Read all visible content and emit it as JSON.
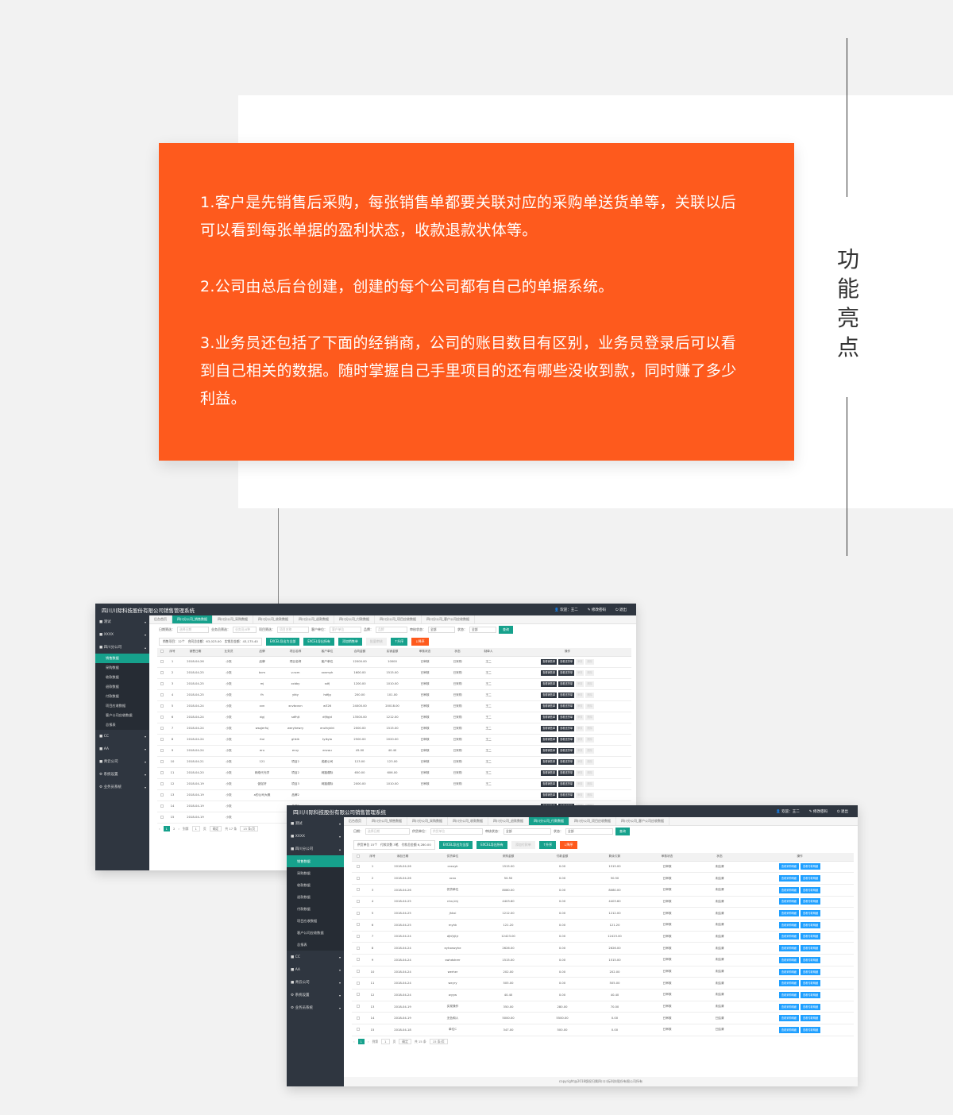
{
  "intro": {
    "p1": "1.客户是先销售后采购，每张销售单都要关联对应的采购单送货单等，关联以后可以看到每张单据的盈利状态，收款退款状体等。",
    "p2": "2.公司由总后台创建，创建的每个公司都有自己的单据系统。",
    "p3": "3.业务员还包括了下面的经销商，公司的账目数目有区别，业务员登录后可以看到自己相关的数据。随时掌握自己手里项目的还有哪些没收到款，同时赚了多少利益。"
  },
  "highlight_title": [
    "功",
    "能",
    "亮",
    "点"
  ],
  "colors": {
    "orange": "#fe5a1d",
    "teal": "#16a18c",
    "sidebar": "#2f3640",
    "blue": "#1e9fff"
  },
  "app": {
    "title": "四川川际科技股份有限公司销售管理系统",
    "welcome": "欢迎：王二",
    "change_pwd": "修改密码",
    "logout": "退出",
    "menu": {
      "m1": "测试",
      "m2": "XXXX",
      "m3": "四川分公司",
      "subs": [
        "销售数据",
        "采购数据",
        "收款数据",
        "退款数据",
        "付款数据",
        "项目应收数据",
        "客户公司应收数据",
        "总报表"
      ],
      "m4": "CC",
      "m5": "AA",
      "m6": "青云公司",
      "m7": "系统设置",
      "m8": "业务员系统"
    }
  },
  "sales": {
    "tabs": [
      "后台首页",
      "四川分公司_销售数据",
      "四川分公司_采购数据",
      "四川分公司_收款数据",
      "四川分公司_退款数据",
      "四川分公司_付款数据",
      "四川分公司_项目应收数据",
      "四川分公司_客户公司应收数据"
    ],
    "filter": {
      "date_label": "日期筛选：",
      "date_ph": "选择日期",
      "staff_label": "业务员筛选：",
      "staff_ph": "业务员(6种",
      "proj_label": "项目筛选：",
      "proj_ph": "项目名称",
      "cust_label": "客户单位：",
      "cust_ph": "客户单位",
      "brand_label": "品牌：",
      "brand_ph": "品牌",
      "audit_label": "审核状态：",
      "audit_val": "全部",
      "state_label": "状态：",
      "state_val": "全部",
      "query": "查询"
    },
    "summary": {
      "a": "销售项目：12个",
      "b": "合同总金额：63,023.00",
      "c": "实销总金额：43,175.40"
    },
    "buttons": {
      "export_all": "EXCEL导出为全部",
      "export": "EXCEL导出所有",
      "add": "添加销售单",
      "batch": "批量审核",
      "asc": "↑升序",
      "desc": "↓降序"
    },
    "headers": [
      "序号",
      "销售日期",
      "业务员",
      "品牌",
      "项目名称",
      "客户单位",
      "合同金额",
      "实销金额",
      "审核状态",
      "状态",
      "制单人",
      "操作"
    ],
    "op_labels": {
      "a": "查看销售单",
      "b": "查看送货单",
      "c": "审核",
      "d": "删除"
    },
    "rows": [
      [
        "1",
        "2018-04-26",
        "小张",
        "品牌",
        "项目名称",
        "客户单位",
        "12000.00",
        "10000",
        "已审核",
        "已采购",
        "王二"
      ],
      [
        "2",
        "2018-04-25",
        "小张",
        "bcm",
        "v.ncm",
        "xxnmyh",
        "1600.00",
        "1515.00",
        "已审核",
        "已采购",
        "王二"
      ],
      [
        "3",
        "2018-04-25",
        "小张",
        "mj",
        "xcbby",
        "sdfj",
        "1200.00",
        "1010.00",
        "已审核",
        "已采购",
        "王二"
      ],
      [
        "4",
        "2018-04-25",
        "小张",
        "fh",
        "ykty",
        "hdfjg",
        "200.00",
        "101.00",
        "已审核",
        "已采购",
        "王二"
      ],
      [
        "5",
        "2018-04-24",
        "小张",
        "xvn",
        "xcvbcxvn",
        "w326",
        "24000.00",
        "20018.00",
        "已审核",
        "已采购",
        "王二"
      ],
      [
        "6",
        "2018-04-24",
        "小张",
        "dgj",
        "sdfhjt",
        "dfjfgjd",
        "13500.00",
        "1212.00",
        "已审核",
        "已采购",
        "王二"
      ],
      [
        "7",
        "2018-04-24",
        "小张",
        "wsqjerfuj",
        "weryhewry",
        "eruthykkt",
        "2000.00",
        "1515.00",
        "已审核",
        "已采购",
        "王二"
      ],
      [
        "8",
        "2018-04-24",
        "小张",
        "rtui",
        "ghkik",
        "tyikyio",
        "2500.00",
        "2020.00",
        "已审核",
        "已采购",
        "王二"
      ],
      [
        "9",
        "2018-04-24",
        "小张",
        "eru",
        "eruy",
        "eruwu",
        "45.00",
        "40.40",
        "已审核",
        "已采购",
        "王二"
      ],
      [
        "10",
        "2018-04-21",
        "小张",
        "121",
        "项目2",
        "成都公司",
        "123.00",
        "123.00",
        "已审核",
        "已采购",
        "王二"
      ],
      [
        "11",
        "2018-04-20",
        "小张",
        "网络代光学",
        "项目2",
        "网路遭际",
        "650.00",
        "606.00",
        "已审核",
        "已采购",
        "王二"
      ],
      [
        "12",
        "2018-04-19",
        "小张",
        "促促好",
        "项目3",
        "网路遭际",
        "2000.00",
        "1010.00",
        "已审核",
        "已采购",
        "王二"
      ],
      [
        "13",
        "2018-04-19",
        "小张",
        "a的公司大概",
        "品牌2",
        "",
        "",
        "",
        "",
        "",
        ""
      ],
      [
        "14",
        "2018-04-19",
        "小张",
        "",
        "品牌3",
        "",
        "",
        "",
        "",
        "",
        ""
      ],
      [
        "15",
        "2018-04-19",
        "小张",
        "",
        "2",
        "",
        "",
        "",
        "",
        "",
        ""
      ]
    ],
    "pager": {
      "p1": "1",
      "p2": "2",
      "to": "到第",
      "page": "1",
      "unit": "页",
      "ok": "确定",
      "total": "共 17 条",
      "size": "15 条/页"
    }
  },
  "payment": {
    "tabs": [
      "后台首页",
      "四川分公司_销售数据",
      "四川分公司_采购数据",
      "四川分公司_收款数据",
      "四川分公司_退款数据",
      "四川分公司_付款数据",
      "四川分公司_项目应收数据",
      "四川分公司_客户公司应收数据"
    ],
    "filter": {
      "date_label": "日期：",
      "date_ph": "选择日期",
      "sup_label": "供货单位：",
      "sup_ph": "供货单位",
      "audit_label": "审核状态：",
      "audit_val": "全部",
      "state_label": "状态：",
      "state_val": "全部",
      "query": "查询"
    },
    "summary": {
      "a": "供货单位 15个",
      "b": "付款次数 3笔",
      "c": "付款总金额 6,280.00"
    },
    "buttons": {
      "export_all": "EXCEL导出为全部",
      "export": "EXCEL导出所有",
      "add": "添加付款单",
      "asc": "↑升序",
      "desc": "↓降序"
    },
    "headers": [
      "序号",
      "添加日期",
      "供货单位",
      "采购金额",
      "付款金额",
      "剩余欠款",
      "审核状态",
      "状态",
      "操作"
    ],
    "op_labels": {
      "a": "查看采购明细",
      "b": "查看付款明细"
    },
    "rows": [
      [
        "1",
        "2018-04-26",
        "cxxuyk",
        "1515.00",
        "0.00",
        "1515.00",
        "已审核",
        "未结清"
      ],
      [
        "2",
        "2018-04-26",
        "xcvx",
        "50.50",
        "0.00",
        "50.50",
        "已审核",
        "未结清"
      ],
      [
        "3",
        "2018-04-26",
        "供货单位",
        "8080.00",
        "0.00",
        "8080.00",
        "已审核",
        "未结清"
      ],
      [
        "4",
        "2018-04-25",
        "nhn,khj",
        "4403.60",
        "0.00",
        "4403.60",
        "已审核",
        "未结清"
      ],
      [
        "5",
        "2018-04-25",
        "jhkxi",
        "1212.00",
        "0.00",
        "1212.00",
        "已审核",
        "未结清"
      ],
      [
        "6",
        "2018-04-25",
        "myhk",
        "121.20",
        "0.00",
        "121.20",
        "已审核",
        "未结清"
      ],
      [
        "7",
        "2018-04-24",
        "djhfjrjtjr",
        "12423.00",
        "0.00",
        "12423.00",
        "已审核",
        "未结清"
      ],
      [
        "8",
        "2018-04-24",
        "eyhxewyhe",
        "2626.00",
        "0.00",
        "2626.00",
        "已审核",
        "未结清"
      ],
      [
        "9",
        "2018-04-24",
        "swhdshrer",
        "1515.00",
        "0.00",
        "1515.00",
        "已审核",
        "未结清"
      ],
      [
        "10",
        "2018-04-24",
        "werher",
        "202.00",
        "0.00",
        "202.00",
        "已审核",
        "未结清"
      ],
      [
        "11",
        "2018-04-24",
        "weyry",
        "505.00",
        "0.00",
        "505.00",
        "已审核",
        "未结清"
      ],
      [
        "12",
        "2018-04-24",
        "wyyw",
        "40.40",
        "0.00",
        "40.40",
        "已审核",
        "未结清"
      ],
      [
        "13",
        "2018-04-19",
        "实现操作",
        "350.00",
        "280.00",
        "70.00",
        "已审核",
        "未结清"
      ],
      [
        "14",
        "2018-04-19",
        "无色和人",
        "5000.00",
        "5500.00",
        "0.00",
        "已审核",
        "已结清"
      ],
      [
        "15",
        "2018-04-18",
        "单位C",
        "347.00",
        "500.00",
        "0.00",
        "已审核",
        "已结清"
      ]
    ],
    "pager": {
      "p1": "1",
      "to": "到第",
      "page": "1",
      "unit": "页",
      "ok": "确定",
      "total": "共 15 条",
      "size": "15 条/页"
    },
    "footer": "copyright@2018版权归属四川川际科技股份有限公司所有"
  }
}
